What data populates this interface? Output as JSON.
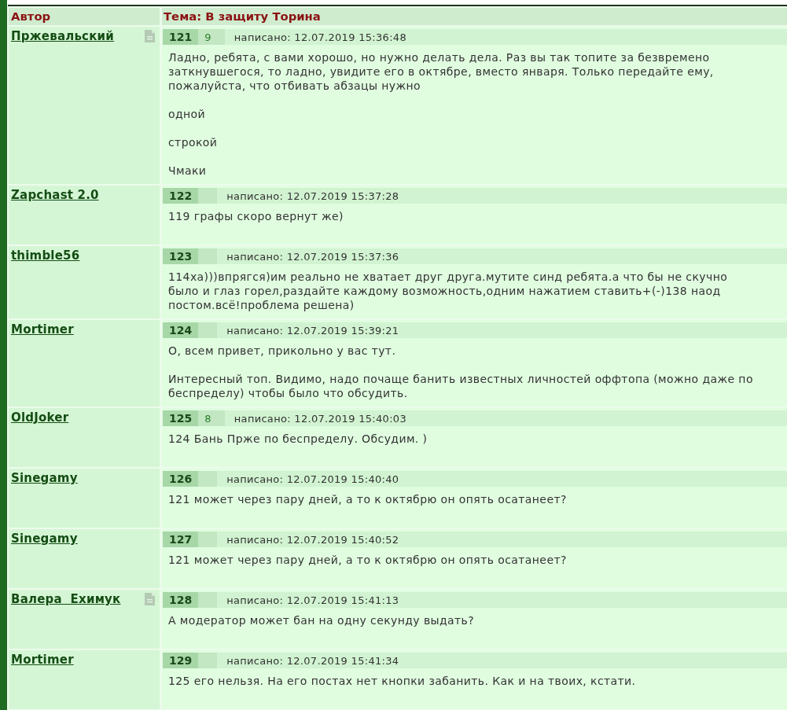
{
  "table": {
    "columns": [
      "Автор",
      "Тема: В защиту Торина"
    ]
  },
  "posts": [
    {
      "author": "Пржевальский",
      "has_note": true,
      "number": "121",
      "rating": "9",
      "posted": "написано: 12.07.2019 15:36:48",
      "paragraphs": [
        "Ладно, ребята, с вами хорошо, но нужно делать дела. Раз вы так топите за безвремено заткнувшегося, то ладно, увидите его в октябре, вместо января. Только передайте ему, пожалуйста, что отбивать абзацы нужно",
        "одной",
        "строкой",
        "Чмаки"
      ]
    },
    {
      "author": "Zapchast 2.0",
      "has_note": false,
      "number": "122",
      "posted": "написано: 12.07.2019 15:37:28",
      "paragraphs": [
        "119 графы скоро вернут же)"
      ]
    },
    {
      "author": "thimble56",
      "has_note": false,
      "number": "123",
      "posted": "написано: 12.07.2019 15:37:36",
      "paragraphs": [
        "114ха)))впрягся)им реально не хватает друг друга.мутите синд ребята.а что бы не скучно было и глаз горел,раздайте каждому возможность,одним нажатием ставить+(-)138 наод постом.всё!проблема решена)"
      ]
    },
    {
      "author": "Mortimer",
      "has_note": false,
      "number": "124",
      "posted": "написано: 12.07.2019 15:39:21",
      "paragraphs": [
        "О, всем привет, прикольно у вас тут.",
        "Интересный топ. Видимо, надо почаще банить известных личностей оффтопа (можно даже по беспределу) чтобы было что обсудить."
      ]
    },
    {
      "author": "OldJoker",
      "has_note": false,
      "number": "125",
      "rating": "8",
      "posted": "написано: 12.07.2019 15:40:03",
      "paragraphs": [
        "124 Бань Прже по беспределу. Обсудим. )"
      ]
    },
    {
      "author": "Sinegamy",
      "has_note": false,
      "number": "126",
      "posted": "написано: 12.07.2019 15:40:40",
      "paragraphs": [
        "121 может через пару дней, а то к октябрю он опять осатанеет?"
      ]
    },
    {
      "author": "Sinegamy",
      "has_note": false,
      "number": "127",
      "posted": "написано: 12.07.2019 15:40:52",
      "paragraphs": [
        "121 может через пару дней, а то к октябрю он опять осатанеет?"
      ]
    },
    {
      "author": "Валера  Ехимук",
      "has_note": true,
      "number": "128",
      "posted": "написано: 12.07.2019 15:41:13",
      "paragraphs": [
        "А модератор может бан на одну секунду выдать?"
      ]
    },
    {
      "author": "Mortimer",
      "has_note": false,
      "number": "129",
      "posted": "написано: 12.07.2019 15:41:34",
      "paragraphs": [
        "125 его нельзя. На его постах нет кнопки забанить. Как и на твоих, кстати."
      ]
    }
  ]
}
